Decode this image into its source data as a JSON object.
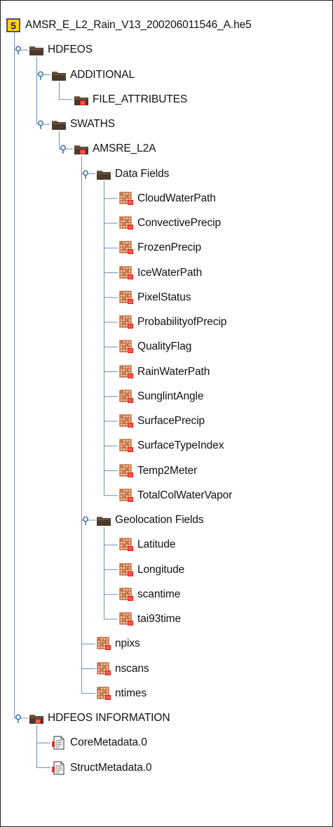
{
  "tree": {
    "colors": {
      "line": "#6f8fb8",
      "handle": "#3b6ea8",
      "folder": "#4b3a2a",
      "folder_tab": "#7a6146",
      "grid": "#b2542b",
      "grid_light": "#f0c8a0",
      "red_marker": "#d81e1e",
      "root_badge_bg": "#ffd400",
      "root_badge_fg": "#1a1a7a"
    },
    "nodes": [
      {
        "label": "AMSR_E_L2_Rain_V13_200206011546_A.he5",
        "icon": "hdf5-file-icon",
        "level": 0,
        "expanded": true,
        "last": true
      },
      {
        "label": "HDFEOS",
        "icon": "folder-icon",
        "level": 1,
        "expanded": true,
        "last": false
      },
      {
        "label": "ADDITIONAL",
        "icon": "folder-icon",
        "level": 2,
        "expanded": true,
        "last": false
      },
      {
        "label": "FILE_ATTRIBUTES",
        "icon": "folder-attribute-icon",
        "level": 3,
        "expanded": false,
        "last": true
      },
      {
        "label": "SWATHS",
        "icon": "folder-icon",
        "level": 2,
        "expanded": true,
        "last": true
      },
      {
        "label": "AMSRE_L2A",
        "icon": "folder-attribute-icon",
        "level": 3,
        "expanded": true,
        "last": true
      },
      {
        "label": "Data Fields",
        "icon": "folder-icon",
        "level": 4,
        "expanded": true,
        "last": false
      },
      {
        "label": "CloudWaterPath",
        "icon": "dataset-icon",
        "level": 5,
        "last": false
      },
      {
        "label": "ConvectivePrecip",
        "icon": "dataset-icon",
        "level": 5,
        "last": false
      },
      {
        "label": "FrozenPrecip",
        "icon": "dataset-icon",
        "level": 5,
        "last": false
      },
      {
        "label": "IceWaterPath",
        "icon": "dataset-icon",
        "level": 5,
        "last": false
      },
      {
        "label": "PixelStatus",
        "icon": "dataset-icon",
        "level": 5,
        "last": false
      },
      {
        "label": "ProbabilityofPrecip",
        "icon": "dataset-icon",
        "level": 5,
        "last": false
      },
      {
        "label": "QualityFlag",
        "icon": "dataset-icon",
        "level": 5,
        "last": false
      },
      {
        "label": "RainWaterPath",
        "icon": "dataset-icon",
        "level": 5,
        "last": false
      },
      {
        "label": "SunglintAngle",
        "icon": "dataset-icon",
        "level": 5,
        "last": false
      },
      {
        "label": "SurfacePrecip",
        "icon": "dataset-icon",
        "level": 5,
        "last": false
      },
      {
        "label": "SurfaceTypeIndex",
        "icon": "dataset-icon",
        "level": 5,
        "last": false
      },
      {
        "label": "Temp2Meter",
        "icon": "dataset-icon",
        "level": 5,
        "last": false
      },
      {
        "label": "TotalColWaterVapor",
        "icon": "dataset-icon",
        "level": 5,
        "last": true
      },
      {
        "label": "Geolocation Fields",
        "icon": "folder-icon",
        "level": 4,
        "expanded": true,
        "last": true
      },
      {
        "label": "Latitude",
        "icon": "dataset-icon",
        "level": 5,
        "last": false
      },
      {
        "label": "Longitude",
        "icon": "dataset-icon",
        "level": 5,
        "last": false
      },
      {
        "label": "scantime",
        "icon": "dataset-icon",
        "level": 5,
        "last": false
      },
      {
        "label": "tai93time",
        "icon": "dataset-icon",
        "level": 5,
        "last": true
      },
      {
        "label": "npixs",
        "icon": "dataset-icon",
        "level": 4,
        "last": false
      },
      {
        "label": "nscans",
        "icon": "dataset-icon",
        "level": 4,
        "last": false
      },
      {
        "label": "ntimes",
        "icon": "dataset-icon",
        "level": 4,
        "last": true
      },
      {
        "label": "HDFEOS INFORMATION",
        "icon": "folder-attribute-icon",
        "level": 1,
        "expanded": true,
        "last": true
      },
      {
        "label": "CoreMetadata.0",
        "icon": "text-document-icon",
        "level": 2,
        "last": false
      },
      {
        "label": "StructMetadata.0",
        "icon": "text-document-icon",
        "level": 2,
        "last": true
      }
    ]
  }
}
